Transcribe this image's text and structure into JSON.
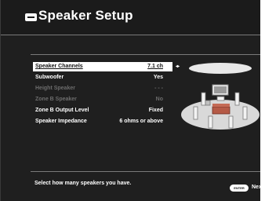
{
  "header": {
    "title": "Speaker Setup",
    "icon": "setup-menu-icon"
  },
  "settings": [
    {
      "label": "Speaker Channels",
      "value": "7.1 ch",
      "state": "selected"
    },
    {
      "label": "Subwoofer",
      "value": "Yes",
      "state": "normal"
    },
    {
      "label": "Height Speaker",
      "value": "- - -",
      "state": "disabled"
    },
    {
      "label": "Zone B Speaker",
      "value": "No",
      "state": "disabled"
    },
    {
      "label": "Zone B Output Level",
      "value": "Fixed",
      "state": "normal"
    },
    {
      "label": "Speaker Impedance",
      "value": "6 ohms or above",
      "state": "normal"
    }
  ],
  "footer": {
    "help_text": "Select how many speakers you have.",
    "enter_button_label": "ENTER",
    "next_label": "Next"
  },
  "colors": {
    "background": "#1f1f1f",
    "text": "#ffffff",
    "disabled_text": "#6c6c6c",
    "selection_highlight": "#ffffff"
  }
}
